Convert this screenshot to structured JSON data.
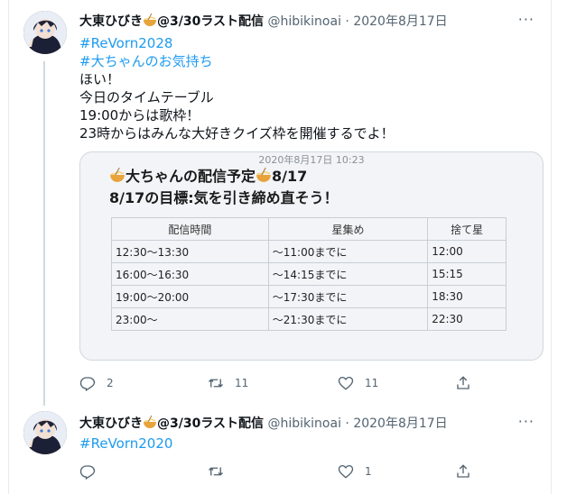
{
  "tweets": [
    {
      "display_name": "大東ひびき",
      "name_suffix": "@3/30ラスト配信",
      "handle": "@hibikinoai",
      "separator": "·",
      "date": "2020年8月17日",
      "lines": [
        "#ReVorn2028",
        "#大ちゃんのお気持ち",
        "ほい！",
        "今日のタイムテーブル",
        "19:00からは歌枠！",
        "23時からはみんな大好きクイズ枠を開催するでよ！"
      ],
      "media": {
        "timestamp": "2020年8月17日 10:23",
        "title": "大ちゃんの配信予定",
        "title_date": "8/17",
        "goal": "8/17の目標:気を引き締め直そう！",
        "table": {
          "headers": [
            "配信時間",
            "星集め",
            "捨て星"
          ],
          "rows": [
            [
              "12:30〜13:30",
              "〜11:00までに",
              "12:00"
            ],
            [
              "16:00〜16:30",
              "〜14:15までに",
              "15:15"
            ],
            [
              "19:00〜20:00",
              "〜17:30までに",
              "18:30"
            ],
            [
              "23:00〜",
              "〜21:30までに",
              "22:30"
            ]
          ]
        }
      },
      "replies": "2",
      "retweets": "11",
      "likes": "11"
    },
    {
      "display_name": "大東ひびき",
      "name_suffix": "@3/30ラスト配信",
      "handle": "@hibikinoai",
      "separator": "·",
      "date": "2020年8月17日",
      "lines": [
        "#ReVorn2020"
      ],
      "replies": "",
      "retweets": "",
      "likes": "1"
    }
  ],
  "icons": [
    "reply-icon",
    "retweet-icon",
    "like-icon",
    "share-icon",
    "more-icon",
    "noodle-emoji-icon"
  ],
  "colors": {
    "hashtag": "#1d9bf0",
    "secondary": "#536471",
    "border": "#cfd9de"
  }
}
